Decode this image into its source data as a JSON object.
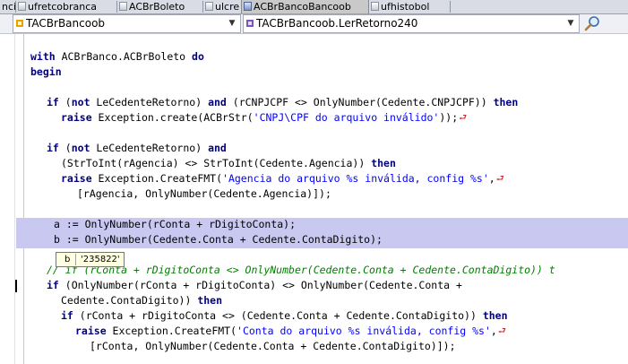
{
  "tabs": [
    {
      "label": "nci",
      "active": false
    },
    {
      "label": "ufretcobranca",
      "active": false
    },
    {
      "label": "ACBrBoleto",
      "active": false
    },
    {
      "label": "ulcre",
      "active": false
    },
    {
      "label": "ACBrBancoBancoob",
      "active": true
    },
    {
      "label": "ufhistobol",
      "active": false
    }
  ],
  "selectors": {
    "class_value": "TACBrBancoob",
    "method_value": "TACBrBancoob.LerRetorno240"
  },
  "code": {
    "l1": {
      "kw1": "with",
      "t1": " ACBrBanco.ACBrBoleto ",
      "kw2": "do"
    },
    "l2": {
      "kw1": "begin"
    },
    "l3": {
      "kw1": "if",
      "t1": " (",
      "kw2": "not",
      "t2": " LeCedenteRetorno) ",
      "kw3": "and",
      "t3": " (rCNPJCPF <> OnlyNumber(Cedente.CNPJCPF)) ",
      "kw4": "then"
    },
    "l4": {
      "kw1": "raise",
      "t1": " Exception.create(ACBrStr(",
      "s1": "'CNPJ\\CPF do arquivo inválido'",
      "t2": "));"
    },
    "l5": {
      "kw1": "if",
      "t1": " (",
      "kw2": "not",
      "t2": " LeCedenteRetorno) ",
      "kw3": "and"
    },
    "l6": {
      "t1": "(StrToInt(rAgencia) <> StrToInt(Cedente.Agencia)) ",
      "kw1": "then"
    },
    "l7": {
      "kw1": "raise",
      "t1": " Exception.CreateFMT(",
      "s1": "'Agencia do arquivo %s inválida, config %s'",
      "t2": ","
    },
    "l8": {
      "t1": "[rAgencia, OnlyNumber(Cedente.Agencia)]);"
    },
    "l9": {
      "t1": "a := OnlyNumber(rConta + rDigitoConta);"
    },
    "l10": {
      "t1": "b := OnlyNumber(Cedente.Conta + Cedente.ContaDigito);"
    },
    "l11": {
      "c1": "// if (rConta + rDigitoConta <> OnlyNumber(Cedente.Conta + Cedente.ContaDigito)) t"
    },
    "l12": {
      "kw1": "if",
      "t1": " (OnlyNumber(rConta + rDigitoConta) <> OnlyNumber(Cedente.Conta +"
    },
    "l13": {
      "t1": "Cedente.ContaDigito)) ",
      "kw1": "then"
    },
    "l14": {
      "kw1": "if",
      "t1": " (rConta + rDigitoConta <> (Cedente.Conta + Cedente.ContaDigito)) ",
      "kw2": "then"
    },
    "l15": {
      "kw1": "raise",
      "t1": " Exception.CreateFMT(",
      "s1": "'Conta do arquivo %s inválida, config %s'",
      "t2": ","
    },
    "l16": {
      "t1": "[rConta, OnlyNumber(Cedente.Conta + Cedente.ContaDigito)]);"
    }
  },
  "hint": {
    "name": "b",
    "value": "'235822'"
  },
  "colors": {
    "keyword": "#000080",
    "string": "#0000ff",
    "comment": "#008000",
    "selection": "#c8c8f0",
    "hint_bg": "#ffffe1"
  }
}
